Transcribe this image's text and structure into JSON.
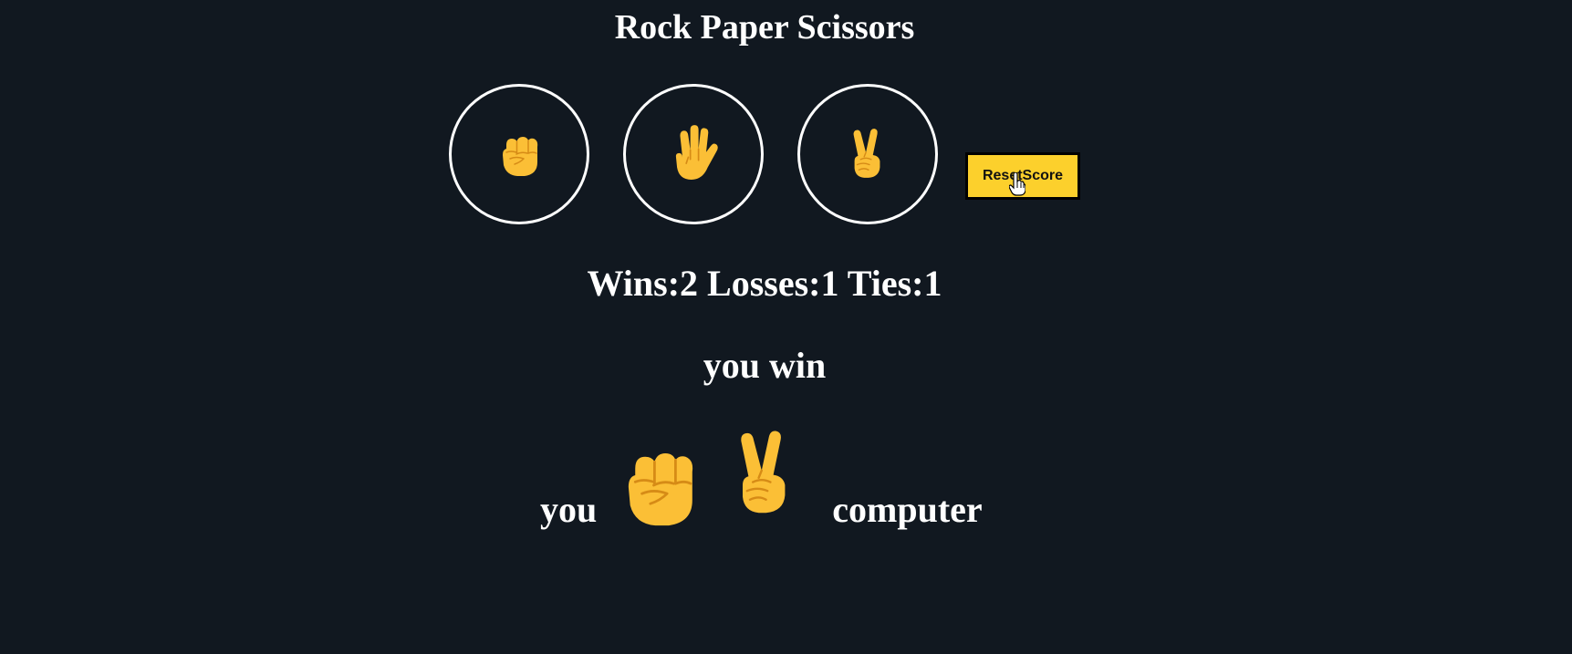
{
  "app": {
    "title": "Rock Paper Scissors"
  },
  "choices": [
    {
      "name": "rock",
      "icon": "raised-fist-icon"
    },
    {
      "name": "paper",
      "icon": "raised-hand-icon"
    },
    {
      "name": "scissors",
      "icon": "victory-hand-icon"
    }
  ],
  "reset_button": {
    "label": "ResetScore",
    "color": "#fcd02c"
  },
  "score": {
    "text": "Wins:2 Losses:1 Ties:1",
    "wins": 2,
    "losses": 1,
    "ties": 1
  },
  "result": {
    "text": "you win"
  },
  "moves": {
    "player_label": "you",
    "player_icon": "raised-fist-icon",
    "computer_icon": "victory-hand-icon",
    "computer_label": "computer"
  },
  "colors": {
    "background": "#111820",
    "text": "#ffffff",
    "emoji": "#fbbf36"
  }
}
